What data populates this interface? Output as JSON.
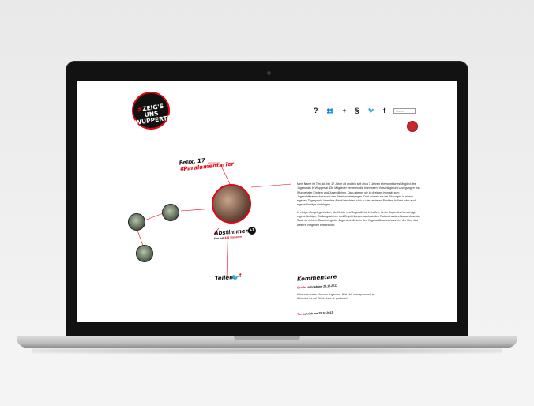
{
  "logo": {
    "line1_hash": "#",
    "line1": "ZEIG'S UNS",
    "line2": "WUPPERTAL"
  },
  "nav": {
    "help": "?",
    "group": "👥",
    "add": "+",
    "paragraph": "§",
    "twitter": "🐦",
    "facebook": "f",
    "search_placeholder": "Suche"
  },
  "profile": {
    "name": "Felix, 17",
    "tag": "#Paralamentarier"
  },
  "vote": {
    "label": "Abstimmen",
    "count_badge": "+1",
    "sub_prefix": "Fim hat",
    "sub_highlight": "426 Stimmen"
  },
  "share": {
    "label": "Teilen"
  },
  "bio": {
    "p1": "Mein Name ist Tim, ich bin 17 Jahre alt und bin seit circa 3 Jahren ehrenamtliches Mitglied des Jugendrats in Wuppertal. Die Mitglieder vertreten die Interessen, Vorschläge und Anregungen von Wuppertaler Kindern und Jugendlichen. Dazu stehen sie in direktem Kontakt zum Jugendhilfeausschuss und den Bezirksvertretungen. Dort können sie bei Sitzungen in einem eigenen Tagespunkt über ihre Arbeit berichten, sich zu den anderen Punkten äußern oder auch eigene Anträge einbringen.",
    "p2": "In einigen Angelegenheiten, die Kinder und Jugendliche betreffen, ist der Jugendrat berechtigt, eigene Anträge, Stellungnahmen und Empfehlungen auch an den Rat und andere Ausschüsse der Stadt zu richten. Dazu bringt der Jugendrat diese in den Jugendhilfeausschuss ein, der über das weitere Vorgehen entscheidet."
  },
  "comments": {
    "title": "Kommentare",
    "c1_author": "Sandra",
    "c1_suffix": "schrieb am 25.10.2013",
    "c1_text": "Höre zum ersten Mal vom Jugendrat. Hört sich aber spannend an. Wünsche dir viel Glück, dass du gewinnst!",
    "c2_author": "Tim",
    "c2_suffix": "schrieb am 25.10.2013"
  },
  "colors": {
    "accent": "#e30613",
    "text": "#111111"
  }
}
